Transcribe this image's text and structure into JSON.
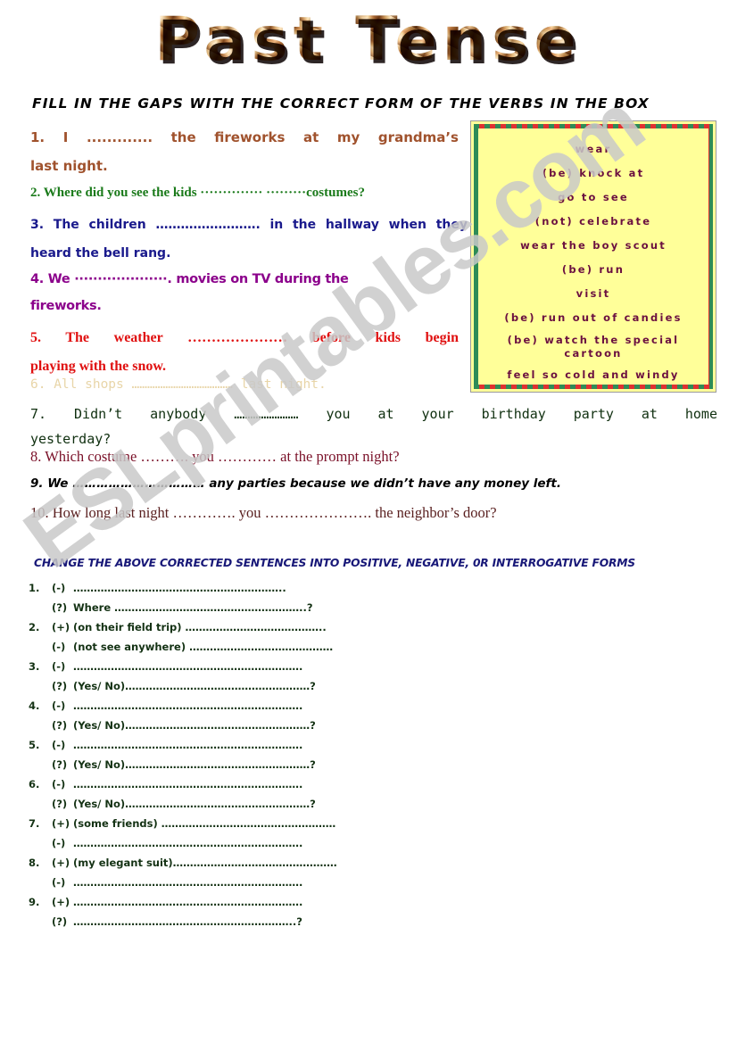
{
  "title": "Past Tense",
  "instruction": "FILL IN THE GAPS WITH THE CORRECT FORM OF THE VERBS IN THE BOX",
  "verb_box": {
    "border_colors": [
      "#2e8b57",
      "#e03030"
    ],
    "background": "#ffff99",
    "text_color": "#6b1040",
    "items": [
      "wear",
      "(be) knock at",
      "go to see",
      "(not) celebrate",
      "wear the boy scout",
      "(be) run",
      "visit",
      "(be) run out of candies",
      "(be) watch the special cartoon",
      "feel so cold and windy"
    ]
  },
  "gapfill": {
    "items": [
      {
        "num": "1.",
        "color": "#a0522d",
        "line1": "I  .............  the  fireworks  at  my  grandma’s",
        "line2": "last night."
      },
      {
        "num": "2.",
        "color": "#1a7a1a",
        "line1": "Where did you see the kids ·············· ·········costumes?",
        "line2": ""
      },
      {
        "num": "3.",
        "color": "#1a1a8c",
        "line1": "The  children  …………………….  in  the  hallway  when  they",
        "line2": "heard  the  bell  rang."
      },
      {
        "num": "4.",
        "color": "#8b008b",
        "line1": "We ····················. movies on TV during    the",
        "line2": "fireworks."
      },
      {
        "num": "5.",
        "color": "#e01010",
        "line1": "The   weather   …………………   before   kids   begin",
        "line2": "playing with the snow."
      },
      {
        "num": "6.",
        "color": "#e8d5a8",
        "line1": "All shops ………………………………… last night.",
        "line2": ""
      },
      {
        "num": "7.",
        "color": "#103010",
        "line1": "Didn’t anybody …………………… you at your    birthday    party    at    home",
        "line2": "yesterday?"
      },
      {
        "num": "8.",
        "color": "#7a1028",
        "line1": "Which costume ………. you ………… at the prompt night?",
        "line2": ""
      },
      {
        "num": "9.",
        "color": "#000000",
        "line1": "We …………………………… any parties because we didn’t have any money left.",
        "line2": ""
      },
      {
        "num": "10.",
        "color": "#5a2020",
        "line1": "How long last night …………. you …………………. the neighbor’s door?",
        "line2": ""
      }
    ]
  },
  "section2": {
    "heading": "CHANGE THE ABOVE CORRECTED SENTENCES INTO POSITIVE, NEGATIVE, 0R INTERROGATIVE FORMS",
    "heading_color": "#181878",
    "text_color": "#143214",
    "items": [
      {
        "num": "1.",
        "rows": [
          {
            "mark": "(-)",
            "text": "…………………………………………………….."
          },
          {
            "mark": "(?)",
            "text": "Where ………………………………………………..?"
          }
        ]
      },
      {
        "num": "2.",
        "rows": [
          {
            "mark": "(+)",
            "text": "(on their field trip) ………………………………….."
          },
          {
            "mark": "(-)",
            "text": "(not see anywhere) ……………………………………"
          }
        ]
      },
      {
        "num": "3.",
        "rows": [
          {
            "mark": "(-)",
            "text": "…………………………………………………………."
          },
          {
            "mark": "(?)",
            "text": "(Yes/ No)………………………………………………?"
          }
        ]
      },
      {
        "num": "4.",
        "rows": [
          {
            "mark": "(-)",
            "text": "…………………………………………………………."
          },
          {
            "mark": "(?)",
            "text": "(Yes/ No)………………………………………………?"
          }
        ]
      },
      {
        "num": "5.",
        "rows": [
          {
            "mark": "(-)",
            "text": "…………………………………………………………."
          },
          {
            "mark": "(?)",
            "text": "(Yes/ No)………………………………………………?"
          }
        ]
      },
      {
        "num": "6.",
        "rows": [
          {
            "mark": "(-)",
            "text": "…………………………………………………………."
          },
          {
            "mark": "(?)",
            "text": "(Yes/ No)………………………………………………?"
          }
        ]
      },
      {
        "num": "7.",
        "rows": [
          {
            "mark": "(+)",
            "text": "(some friends) ……………………………………………"
          },
          {
            "mark": "(-)",
            "text": "…………………………………………………………."
          }
        ]
      },
      {
        "num": "8.",
        "rows": [
          {
            "mark": "(+)",
            "text": "(my elegant suit)…………………………………………"
          },
          {
            "mark": "(-)",
            "text": "…………………………………………………………."
          }
        ]
      },
      {
        "num": "9.",
        "rows": [
          {
            "mark": "(+)",
            "text": "…………………………………………………………."
          },
          {
            "mark": "(?)",
            "text": "………………………………………………………..?"
          }
        ]
      }
    ]
  },
  "watermark": "ESLprintables.com"
}
